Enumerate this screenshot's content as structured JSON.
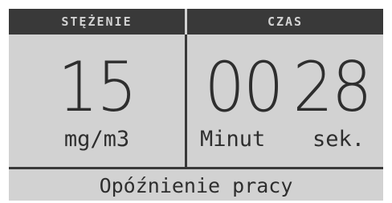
{
  "header": {
    "left_title": "STĘŻENIE",
    "right_title": "CZAS"
  },
  "concentration": {
    "value": "15",
    "unit": "mg/m3"
  },
  "time": {
    "minutes": "00",
    "seconds": "28",
    "minutes_label": "Minut",
    "seconds_label": "sek."
  },
  "status": {
    "text": "Opóźnienie pracy"
  },
  "colors": {
    "screen_background": "#d2d2d2",
    "header_background": "#393939",
    "text": "#2e2e2e"
  }
}
